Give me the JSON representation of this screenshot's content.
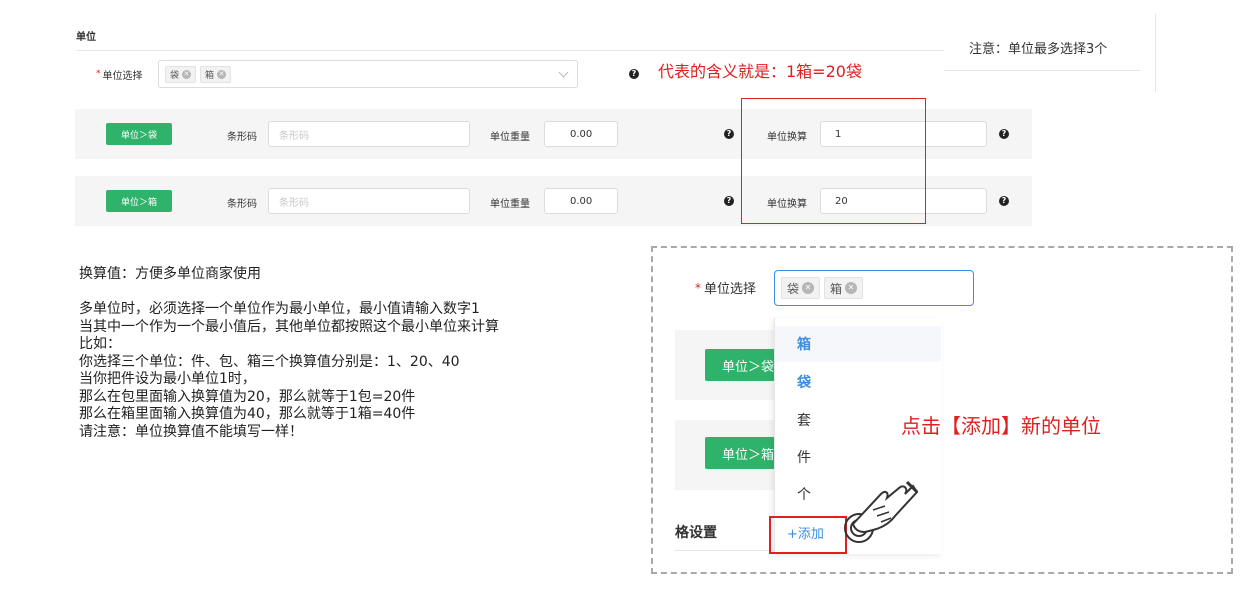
{
  "section": {
    "title": "单位"
  },
  "unit_select": {
    "label": "单位选择",
    "required_mark": "*",
    "tags": [
      "袋",
      "箱"
    ]
  },
  "annotations": {
    "meaning": "代表的含义就是：1箱=20袋",
    "limit_note": "注意：单位最多选择3个",
    "click_add": "点击【添加】新的单位"
  },
  "rows": [
    {
      "unit_button": "单位＞袋",
      "barcode_label": "条形码",
      "barcode_placeholder": "条形码",
      "weight_label": "单位重量",
      "weight_value": "0.00",
      "conv_label": "单位换算",
      "conv_value": "1"
    },
    {
      "unit_button": "单位＞箱",
      "barcode_label": "条形码",
      "barcode_placeholder": "条形码",
      "weight_label": "单位重量",
      "weight_value": "0.00",
      "conv_label": "单位换算",
      "conv_value": "20"
    }
  ],
  "explanation": {
    "lines": [
      "换算值：方便多单位商家使用",
      "",
      "多单位时，必须选择一个单位作为最小单位，最小值请输入数字1",
      "当其中一个作为一个最小值后，其他单位都按照这个最小单位来计算",
      "比如：",
      "你选择三个单位：件、包、箱三个换算值分别是：1、20、40",
      "当你把件设为最小单位1时，",
      "那么在包里面输入换算值为20，那么就等于1包=20件",
      "那么在箱里面输入换算值为40，那么就等于1箱=40件",
      "请注意：单位换算值不能填写一样！"
    ]
  },
  "zoom": {
    "label": "单位选择",
    "required_mark": "*",
    "tags": [
      "袋",
      "箱"
    ],
    "row_buttons": [
      "单位＞袋",
      "单位＞箱"
    ],
    "dropdown_items": [
      "箱",
      "袋",
      "套",
      "件",
      "个"
    ],
    "add_label": "+添加",
    "section_label": "格设置"
  },
  "colors": {
    "accent_red": "#e02020",
    "green": "#2fb36b",
    "blue": "#3a8ee6"
  },
  "icons": {
    "help": "question-circle-icon",
    "chevron": "chevron-down-icon",
    "hand": "pointing-hand-icon"
  }
}
